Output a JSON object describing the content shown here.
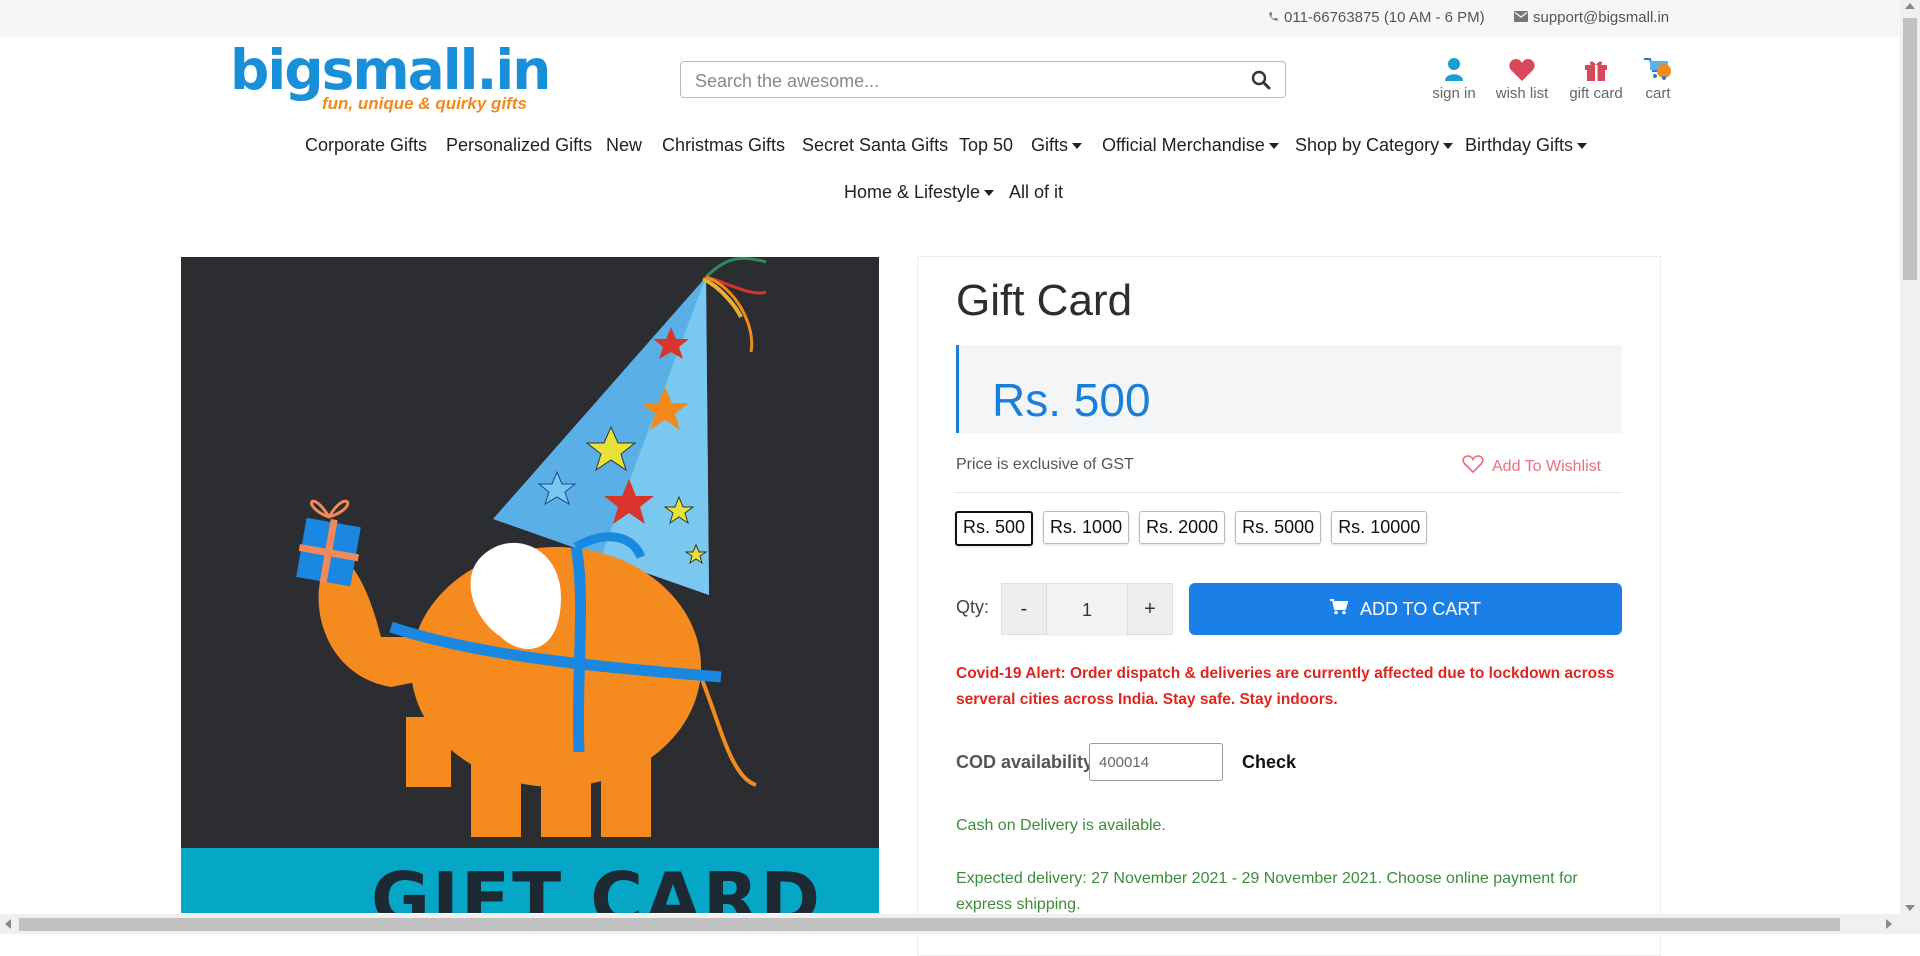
{
  "topbar": {
    "phone": "011-66763875 (10 AM - 6 PM)",
    "email": "support@bigsmall.in"
  },
  "logo": {
    "name": "bigsmall.in",
    "tagline": "fun, unique & quirky gifts"
  },
  "search": {
    "placeholder": "Search the awesome..."
  },
  "header_icons": {
    "sign_in": "sign in",
    "wish_list": "wish list",
    "gift_card": "gift card",
    "cart": "cart"
  },
  "nav": {
    "row1": [
      {
        "label": "Corporate Gifts",
        "dropdown": false
      },
      {
        "label": "Personalized Gifts",
        "dropdown": false
      },
      {
        "label": "New",
        "dropdown": false
      },
      {
        "label": "Christmas Gifts",
        "dropdown": false
      },
      {
        "label": "Secret Santa Gifts",
        "dropdown": false
      },
      {
        "label": "Top 50",
        "dropdown": false
      },
      {
        "label": "Gifts",
        "dropdown": true
      },
      {
        "label": "Official Merchandise",
        "dropdown": true
      },
      {
        "label": "Shop by Category",
        "dropdown": true
      },
      {
        "label": "Birthday Gifts",
        "dropdown": true
      }
    ],
    "row2": [
      {
        "label": "Home & Lifestyle",
        "dropdown": true
      },
      {
        "label": "All of it",
        "dropdown": false
      }
    ]
  },
  "product": {
    "image_banner_text": "GIFT CARD",
    "title": "Gift Card",
    "price": "Rs. 500",
    "gst_note": "Price is exclusive of GST",
    "wishlist_label": "Add To Wishlist",
    "denominations": [
      "Rs. 500",
      "Rs. 1000",
      "Rs. 2000",
      "Rs. 5000",
      "Rs. 10000"
    ],
    "selected_denomination": "Rs. 500",
    "qty_label": "Qty:",
    "qty_minus": "-",
    "qty_value": "1",
    "qty_plus": "+",
    "add_to_cart": "ADD TO CART",
    "covid_alert": "Covid-19 Alert: Order dispatch & deliveries are currently affected due to lockdown across serveral cities across India. Stay safe. Stay indoors.",
    "cod_label": "COD availability",
    "cod_pincode": "400014",
    "check_label": "Check",
    "cod_status": "Cash on Delivery is available.",
    "expected_delivery": "Expected delivery: 27 November 2021 - 29 November 2021. Choose online payment for express shipping."
  },
  "colors": {
    "brand_blue": "#1a8fd9",
    "brand_orange": "#f08a1d",
    "price_blue": "#1a7fd9",
    "cart_button": "#1a7fe6",
    "alert_red": "#e0261d",
    "success_green": "#3d8b3d",
    "wishlist_pink": "#e5727e"
  },
  "icons": [
    "phone-icon",
    "mail-icon",
    "search-icon",
    "user-icon",
    "heart-icon",
    "gift-icon",
    "cart-icon",
    "shopping-cart-icon"
  ]
}
